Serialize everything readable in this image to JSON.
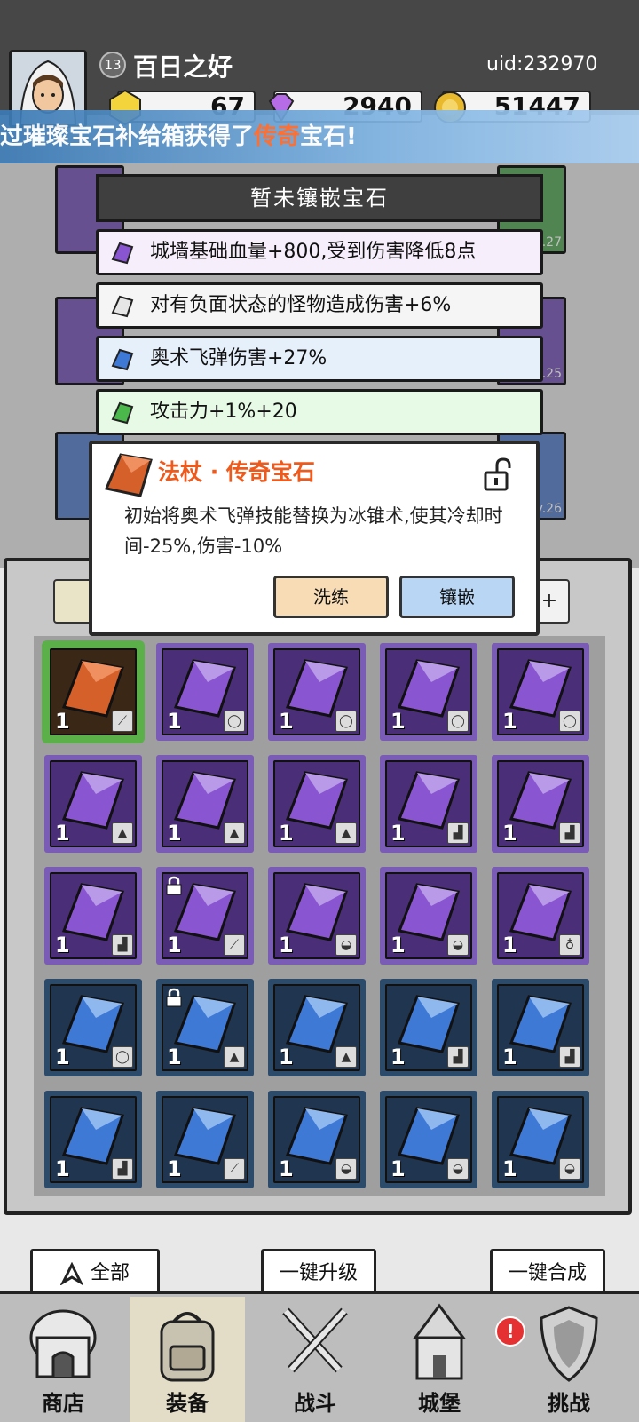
{
  "header": {
    "level": "13",
    "player_name": "百日之好",
    "uid": "uid:232970",
    "currencies": [
      {
        "name": "gold-gem",
        "value": "67",
        "color": "#f3d43c"
      },
      {
        "name": "diamond",
        "value": "2940",
        "color": "#b56ce6"
      },
      {
        "name": "coin",
        "value": "51447",
        "color": "#e8b82d"
      }
    ]
  },
  "announcement": {
    "prefix": "过璀璨宝石补给箱获得了",
    "highlight": "传奇",
    "suffix": "宝石!"
  },
  "background_slots": {
    "levels": [
      "Lv.27",
      "Lv.25",
      "Lv.26"
    ]
  },
  "slot_panel": {
    "title": "暂未镶嵌宝石",
    "stats": [
      {
        "text": "城墙基础血量+800,受到伤害降低8点",
        "gem": "purple",
        "bg": "#f6eefb"
      },
      {
        "text": "对有负面状态的怪物造成伤害+6%",
        "gem": "white",
        "bg": "#f5f5f5"
      },
      {
        "text": "奥术飞弹伤害+27%",
        "gem": "blue",
        "bg": "#e6f0fb"
      },
      {
        "text": "攻击力+1%+20",
        "gem": "green",
        "bg": "#e6fae6"
      }
    ]
  },
  "tooltip": {
    "title": "法杖 · 传奇宝石",
    "description": "初始将奥术飞弹技能替换为冰锥术,使其冷却时间-25%,伤害-10%",
    "reroll_label": "洗练",
    "inlay_label": "镶嵌"
  },
  "inventory": {
    "rows": [
      [
        {
          "gem": "orange",
          "count": "1",
          "slot": "staff",
          "selected": true,
          "locked": false
        },
        {
          "gem": "purple",
          "count": "1",
          "slot": "ring",
          "selected": false,
          "locked": false
        },
        {
          "gem": "purple",
          "count": "1",
          "slot": "ring",
          "selected": false,
          "locked": false
        },
        {
          "gem": "purple",
          "count": "1",
          "slot": "ring",
          "selected": false,
          "locked": false
        },
        {
          "gem": "purple",
          "count": "1",
          "slot": "ring",
          "selected": false,
          "locked": false
        }
      ],
      [
        {
          "gem": "purple",
          "count": "1",
          "slot": "armor",
          "selected": false,
          "locked": false
        },
        {
          "gem": "purple",
          "count": "1",
          "slot": "armor",
          "selected": false,
          "locked": false
        },
        {
          "gem": "purple",
          "count": "1",
          "slot": "armor",
          "selected": false,
          "locked": false
        },
        {
          "gem": "purple",
          "count": "1",
          "slot": "boots",
          "selected": false,
          "locked": false
        },
        {
          "gem": "purple",
          "count": "1",
          "slot": "boots",
          "selected": false,
          "locked": false
        }
      ],
      [
        {
          "gem": "purple",
          "count": "1",
          "slot": "boots",
          "selected": false,
          "locked": false
        },
        {
          "gem": "purple",
          "count": "1",
          "slot": "staff",
          "selected": false,
          "locked": true
        },
        {
          "gem": "purple",
          "count": "1",
          "slot": "hat",
          "selected": false,
          "locked": false
        },
        {
          "gem": "purple",
          "count": "1",
          "slot": "hat",
          "selected": false,
          "locked": false
        },
        {
          "gem": "purple",
          "count": "1",
          "slot": "amulet",
          "selected": false,
          "locked": false
        }
      ],
      [
        {
          "gem": "blue",
          "count": "1",
          "slot": "ring",
          "selected": false,
          "locked": false
        },
        {
          "gem": "blue",
          "count": "1",
          "slot": "armor",
          "selected": false,
          "locked": true
        },
        {
          "gem": "blue",
          "count": "1",
          "slot": "armor",
          "selected": false,
          "locked": false
        },
        {
          "gem": "blue",
          "count": "1",
          "slot": "boots",
          "selected": false,
          "locked": false
        },
        {
          "gem": "blue",
          "count": "1",
          "slot": "boots",
          "selected": false,
          "locked": false
        }
      ],
      [
        {
          "gem": "blue",
          "count": "1",
          "slot": "boots",
          "selected": false,
          "locked": false
        },
        {
          "gem": "blue",
          "count": "1",
          "slot": "staff",
          "selected": false,
          "locked": false
        },
        {
          "gem": "blue",
          "count": "1",
          "slot": "hat",
          "selected": false,
          "locked": false
        },
        {
          "gem": "blue",
          "count": "1",
          "slot": "hat",
          "selected": false,
          "locked": false
        },
        {
          "gem": "blue",
          "count": "1",
          "slot": "hat",
          "selected": false,
          "locked": false
        }
      ]
    ]
  },
  "actions": {
    "filter_label": "全部",
    "upgrade_all_label": "一键升级",
    "merge_all_label": "一键合成"
  },
  "nav": {
    "items": [
      {
        "label": "商店",
        "icon": "shop-icon"
      },
      {
        "label": "装备",
        "icon": "backpack-icon",
        "active": true
      },
      {
        "label": "战斗",
        "icon": "crossed-swords-icon"
      },
      {
        "label": "城堡",
        "icon": "castle-icon"
      },
      {
        "label": "挑战",
        "icon": "shield-icon"
      }
    ],
    "notice_badge": "!"
  },
  "colors": {
    "legendary": "#ee5a1c",
    "purple_cell": "#4a2f78",
    "blue_cell": "#1f3550",
    "orange_cell": "#3b2716"
  }
}
